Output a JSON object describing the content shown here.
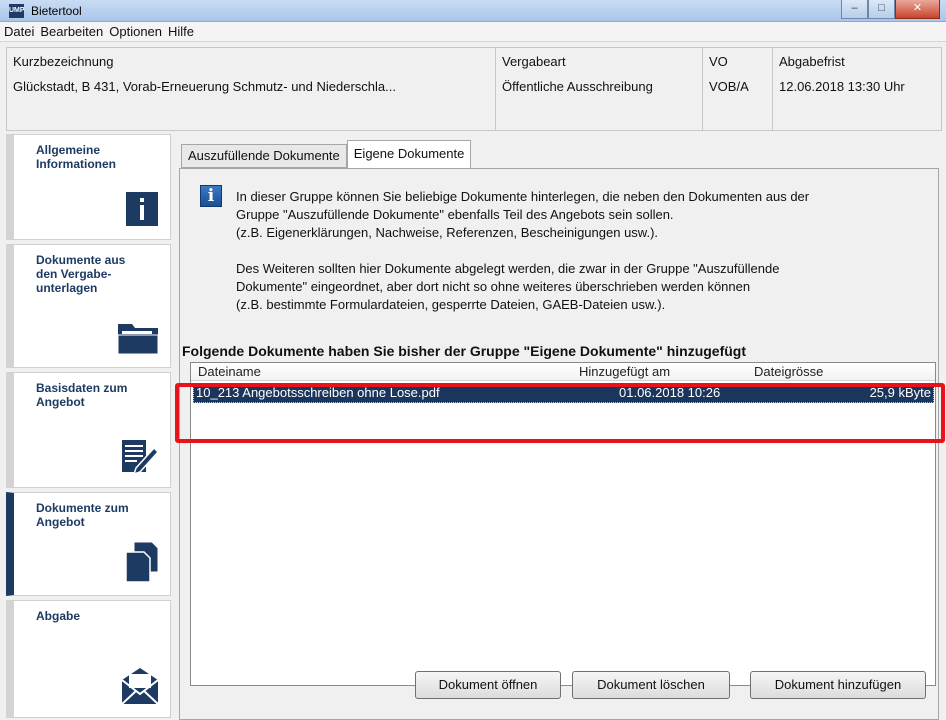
{
  "window": {
    "title": "Bietertool",
    "app_icon_text": "UMP"
  },
  "menu": [
    "Datei",
    "Bearbeiten",
    "Optionen",
    "Hilfe"
  ],
  "header": {
    "kurz_label": "Kurzbezeichnung",
    "kurz_value": "Glückstadt, B 431, Vorab-Erneuerung Schmutz- und Niederschla...",
    "vergabeart_label": "Vergabeart",
    "vergabeart_value": "Öffentliche Ausschreibung",
    "vo_label": "VO",
    "vo_value": "VOB/A",
    "frist_label": "Abgabefrist",
    "frist_value": "12.06.2018 13:30 Uhr"
  },
  "sidebar": [
    {
      "label": "Allgemeine\nInformationen",
      "icon": "info-icon"
    },
    {
      "label": "Dokumente aus\nden Vergabe-\nunterlagen",
      "icon": "folder-icon"
    },
    {
      "label": "Basisdaten zum\nAngebot",
      "icon": "edit-form-icon"
    },
    {
      "label": "Dokumente zum\nAngebot",
      "icon": "documents-icon"
    },
    {
      "label": "Abgabe",
      "icon": "envelope-icon"
    }
  ],
  "tabs": [
    "Auszufüllende Dokumente",
    "Eigene Dokumente"
  ],
  "info": [
    "In dieser Gruppe können Sie beliebige Dokumente hinterlegen, die neben den Dokumenten aus der",
    "Gruppe \"Auszufüllende Dokumente\" ebenfalls Teil des Angebots sein sollen.",
    "(z.B. Eigenerklärungen, Nachweise, Referenzen, Bescheinigungen usw.).",
    "",
    "Des Weiteren sollten hier Dokumente abgelegt werden, die zwar in der Gruppe \"Auszufüllende",
    "Dokumente\" eingeordnet, aber dort nicht so ohne weiteres überschrieben werden können",
    "(z.B. bestimmte Formulardateien, gesperrte Dateien, GAEB-Dateien usw.)."
  ],
  "list_title": "Folgende Dokumente haben Sie bisher der Gruppe \"Eigene Dokumente\" hinzugefügt",
  "columns": [
    "Dateiname",
    "Hinzugefügt am",
    "Dateigrösse"
  ],
  "rows": [
    {
      "name": "10_213 Angebotsschreiben ohne Lose.pdf",
      "date": "01.06.2018 10:26",
      "size": "25,9 kByte"
    }
  ],
  "buttons": {
    "open": "Dokument öffnen",
    "delete": "Dokument löschen",
    "add": "Dokument hinzufügen"
  },
  "colors": {
    "brand": "#1d3a63",
    "highlight": "#e8121a",
    "selection": "#1b365c"
  }
}
